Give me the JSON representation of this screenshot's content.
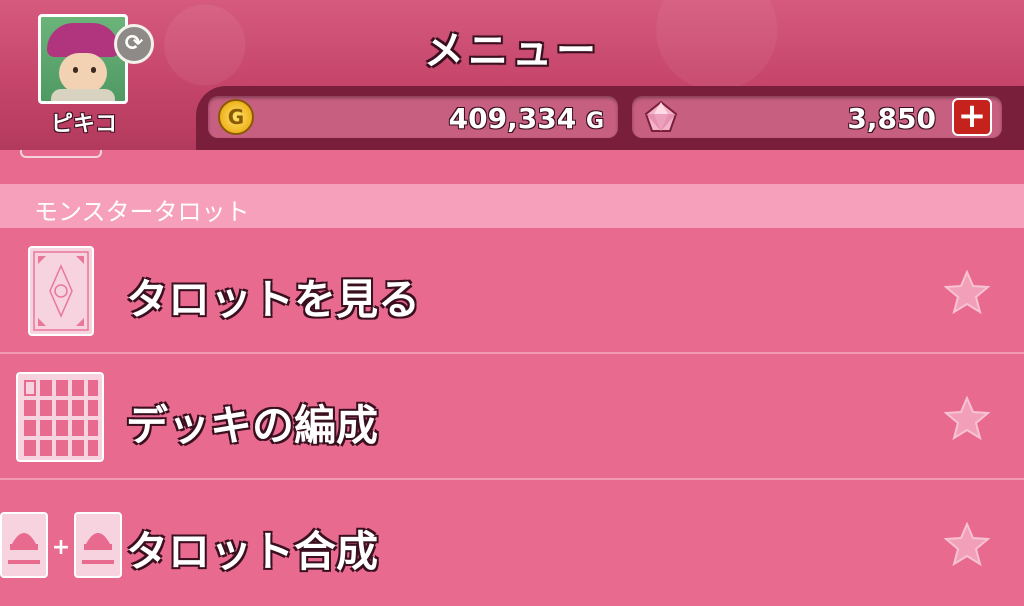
{
  "header": {
    "title": "メニュー",
    "profile": {
      "name": "ピキコ",
      "refresh_icon": "refresh-icon"
    },
    "gold": {
      "value": "409,334",
      "unit": "G",
      "icon": "gold-coin-icon",
      "coin_letter": "G"
    },
    "gems": {
      "value": "3,850",
      "icon": "gem-icon",
      "add_label": "+"
    }
  },
  "section": {
    "label": "モンスタータロット"
  },
  "menu_items": [
    {
      "label": "タロットを見る",
      "icon": "tarot-card-icon",
      "favorite_icon": "star-icon"
    },
    {
      "label": "デッキの編成",
      "icon": "deck-grid-icon",
      "favorite_icon": "star-icon"
    },
    {
      "label": "タロット合成",
      "icon": "tarot-fusion-icon",
      "favorite_icon": "star-icon"
    }
  ],
  "colors": {
    "header": "#c9466b",
    "status_bar": "#7a1f3b",
    "background": "#e96a8f",
    "section_header": "#f7a0bb",
    "plus_button": "#c5221e"
  }
}
